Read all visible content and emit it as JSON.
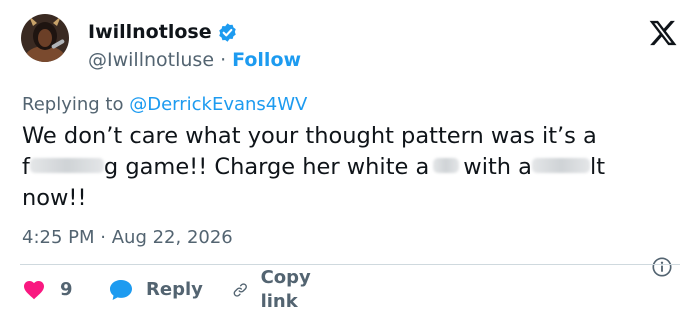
{
  "header": {
    "display_name": "Iwillnotlose",
    "handle": "@Iwillnotluse",
    "separator": "·",
    "follow_label": "Follow"
  },
  "reply_context": {
    "prefix": "Replying to",
    "mention": "@DerrickEvans4WV"
  },
  "tweet": {
    "line1": "We don’t care what your thought pattern was it’s a",
    "seg1": "f",
    "seg2": "g game!! Charge her white a",
    "seg3": "with a",
    "seg4": "lt",
    "line3": "now!!"
  },
  "meta": {
    "time": "4:25 PM",
    "separator": "·",
    "date": "Aug 22, 2026"
  },
  "actions": {
    "like_count": "9",
    "reply_label": "Reply",
    "copy_link_label": "Copy link"
  },
  "colors": {
    "accent": "#1d9bf0",
    "like": "#f91880",
    "muted": "#536471",
    "text": "#0f1419"
  },
  "icons": {
    "verified": "verified-badge-icon",
    "logo": "x-logo-icon",
    "info": "info-icon",
    "like": "heart-icon",
    "reply": "speech-bubble-icon",
    "copy": "link-icon"
  }
}
